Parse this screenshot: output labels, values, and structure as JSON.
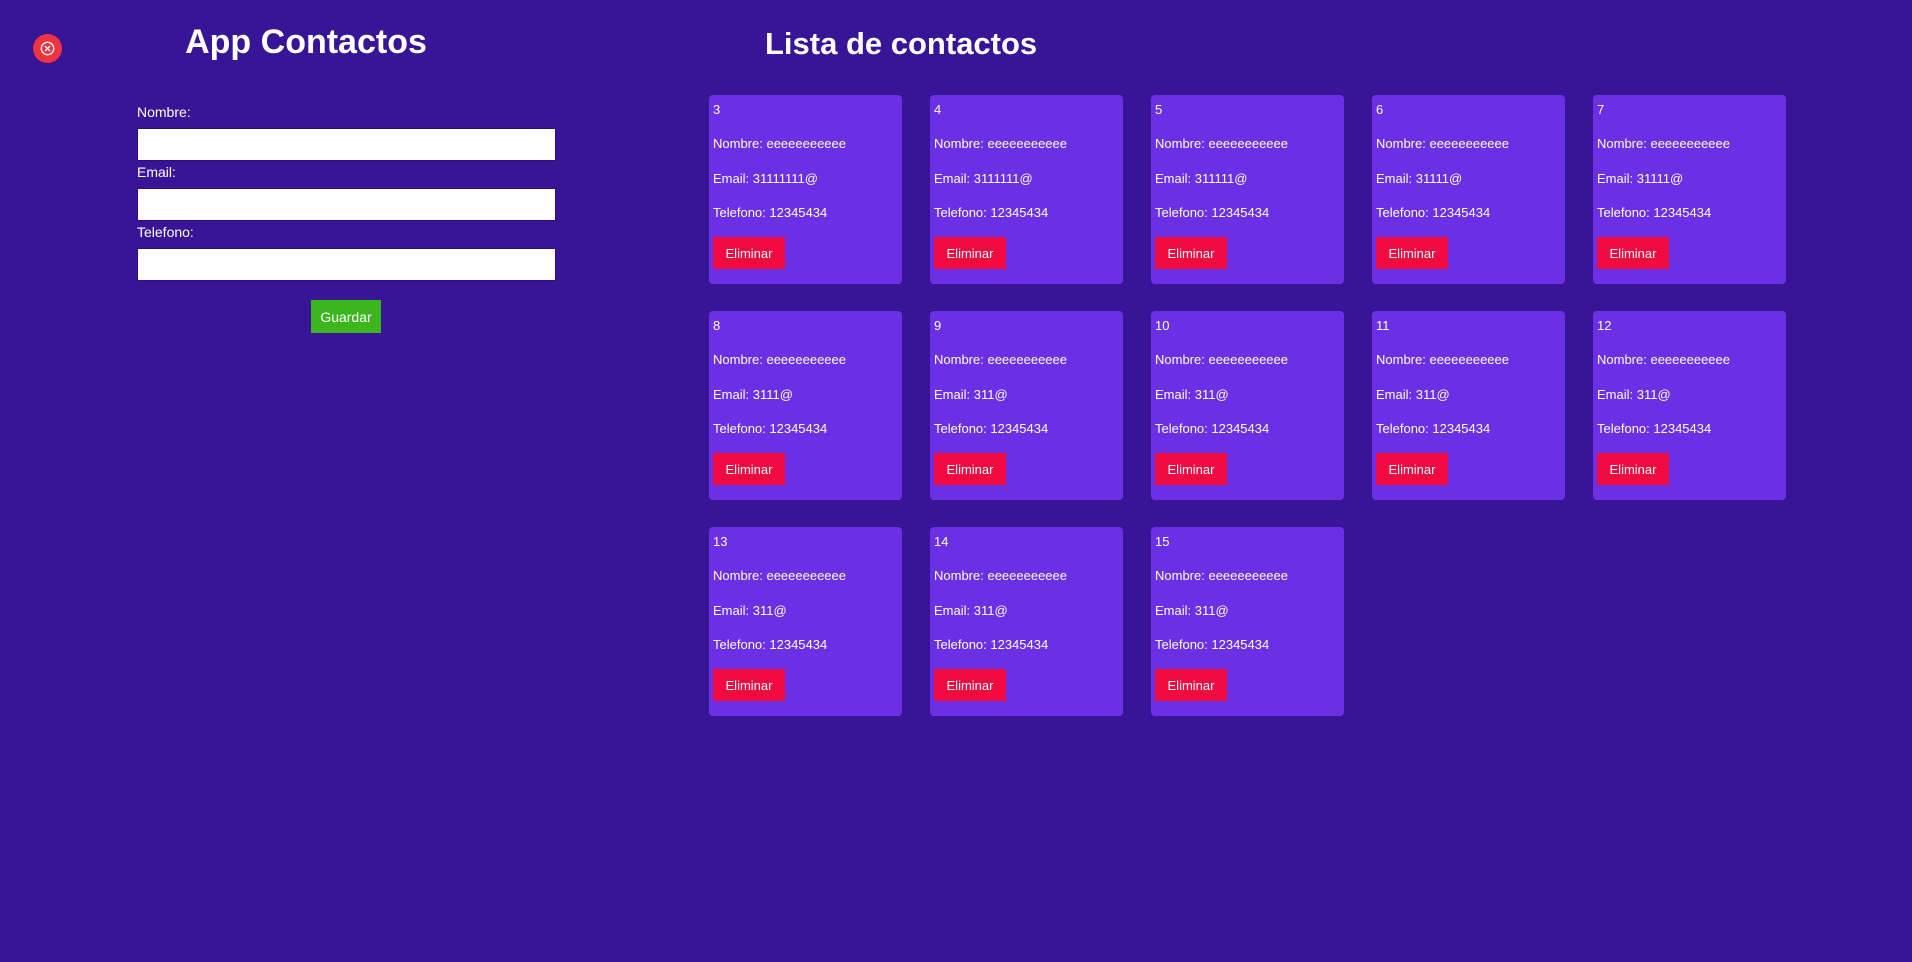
{
  "close_icon": "close-circle-icon",
  "form": {
    "title": "App Contactos",
    "fields": [
      {
        "label": "Nombre:",
        "value": "",
        "placeholder": ""
      },
      {
        "label": "Email:",
        "value": "",
        "placeholder": ""
      },
      {
        "label": "Telefono:",
        "value": "",
        "placeholder": ""
      }
    ],
    "save_label": "Guardar"
  },
  "list": {
    "title": "Lista de contactos",
    "delete_label": "Eliminar",
    "contacts": [
      {
        "id": "3",
        "name": "Nombre: eeeeeeeeeee",
        "email": "Email: 31111111@",
        "phone": "Telefono: 12345434"
      },
      {
        "id": "4",
        "name": "Nombre: eeeeeeeeeee",
        "email": "Email: 3111111@",
        "phone": "Telefono: 12345434"
      },
      {
        "id": "5",
        "name": "Nombre: eeeeeeeeeee",
        "email": "Email: 311111@",
        "phone": "Telefono: 12345434"
      },
      {
        "id": "6",
        "name": "Nombre: eeeeeeeeeee",
        "email": "Email: 31111@",
        "phone": "Telefono: 12345434"
      },
      {
        "id": "7",
        "name": "Nombre: eeeeeeeeeee",
        "email": "Email: 31111@",
        "phone": "Telefono: 12345434"
      },
      {
        "id": "8",
        "name": "Nombre: eeeeeeeeeee",
        "email": "Email: 3111@",
        "phone": "Telefono: 12345434"
      },
      {
        "id": "9",
        "name": "Nombre: eeeeeeeeeee",
        "email": "Email: 311@",
        "phone": "Telefono: 12345434"
      },
      {
        "id": "10",
        "name": "Nombre: eeeeeeeeeee",
        "email": "Email: 311@",
        "phone": "Telefono: 12345434"
      },
      {
        "id": "11",
        "name": "Nombre: eeeeeeeeeee",
        "email": "Email: 311@",
        "phone": "Telefono: 12345434"
      },
      {
        "id": "12",
        "name": "Nombre: eeeeeeeeeee",
        "email": "Email: 311@",
        "phone": "Telefono: 12345434"
      },
      {
        "id": "13",
        "name": "Nombre: eeeeeeeeeee",
        "email": "Email: 311@",
        "phone": "Telefono: 12345434"
      },
      {
        "id": "14",
        "name": "Nombre: eeeeeeeeeee",
        "email": "Email: 311@",
        "phone": "Telefono: 12345434"
      },
      {
        "id": "15",
        "name": "Nombre: eeeeeeeeeee",
        "email": "Email: 311@",
        "phone": "Telefono: 12345434"
      }
    ]
  },
  "colors": {
    "background": "#381596",
    "card": "#6b30e6",
    "delete": "#f10a3f",
    "save": "#3db61e",
    "close": "#ef3340"
  }
}
